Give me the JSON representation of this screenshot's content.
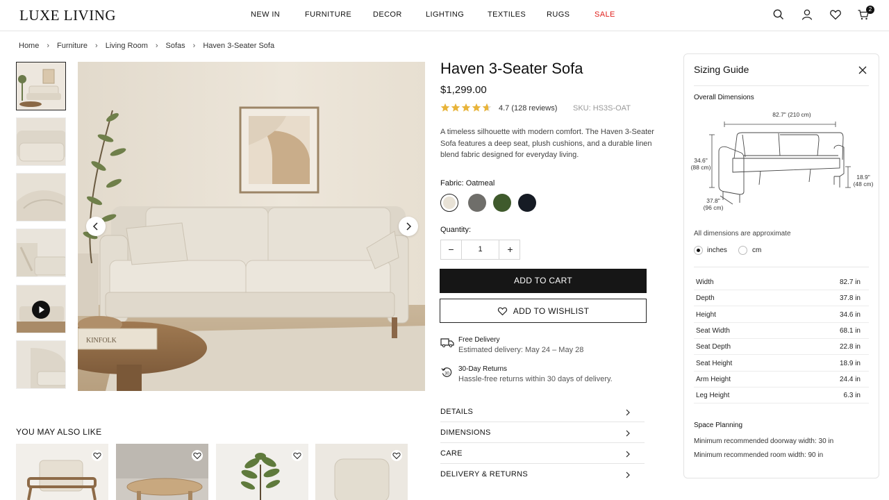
{
  "brand": "LUXE LIVING",
  "nav": [
    "NEW IN",
    "FURNITURE",
    "DECOR",
    "LIGHTING",
    "TEXTILES",
    "RUGS",
    "SALE"
  ],
  "colors": {
    "sale": "#e0201c",
    "star": "#e8b43a",
    "dark": "#161616"
  },
  "header_icons": [
    "search-icon",
    "user-icon",
    "heart-icon",
    "cart-icon"
  ],
  "cart_count": "2",
  "breadcrumb": [
    "Home",
    "Furniture",
    "Living Room",
    "Sofas",
    "Haven 3-Seater Sofa"
  ],
  "product": {
    "title": "Haven 3-Seater Sofa",
    "price": "$1,299.00",
    "rating_value": 4.7,
    "rating_text": "4.7 (128 reviews)",
    "sku": "SKU: HS3S-OAT",
    "description": "A timeless silhouette with modern comfort. The Haven 3-Seater Sofa features a deep seat, plush cushions, and a durable linen blend fabric designed for everyday living.",
    "fabric_label": "Fabric:",
    "fabric_selected": "Oatmeal",
    "swatches": [
      "#e8e2d6",
      "#6f6e6a",
      "#3f5a2c",
      "#161b24"
    ],
    "quantity_label": "Quantity:",
    "quantity": "1",
    "add_to_cart": "ADD TO CART",
    "add_to_wishlist": "ADD TO WISHLIST"
  },
  "perks": [
    {
      "title": "Free Delivery",
      "sub": "Estimated delivery: May 24 – May 28"
    },
    {
      "title": "30-Day Returns",
      "sub": "Hassle-free returns within 30 days of delivery."
    }
  ],
  "accordion": [
    "DETAILS",
    "DIMENSIONS",
    "CARE",
    "DELIVERY & RETURNS"
  ],
  "also_like_title": "YOU MAY ALSO LIKE",
  "sizing": {
    "title": "Sizing Guide",
    "overall": "Overall Dimensions",
    "width_label": "82.7\" (210 cm)",
    "height_label": [
      "34.6\"",
      "(88 cm)"
    ],
    "depth_label": [
      "37.8\"",
      "(96 cm)"
    ],
    "seat_label": [
      "18.9\"",
      "(48 cm)"
    ],
    "note": "All dimensions are approximate",
    "unit_inches": "inches",
    "unit_cm": "cm",
    "specs": [
      {
        "k": "Width",
        "v": "82.7 in"
      },
      {
        "k": "Depth",
        "v": "37.8 in"
      },
      {
        "k": "Height",
        "v": "34.6 in"
      },
      {
        "k": "Seat Width",
        "v": "68.1 in"
      },
      {
        "k": "Seat Depth",
        "v": "22.8 in"
      },
      {
        "k": "Seat Height",
        "v": "18.9 in"
      },
      {
        "k": "Arm Height",
        "v": "24.4 in"
      },
      {
        "k": "Leg Height",
        "v": "6.3 in"
      }
    ],
    "space_title": "Space Planning",
    "space_lines": [
      "Minimum recommended doorway width: 30 in",
      "Minimum recommended room width: 90 in"
    ]
  }
}
